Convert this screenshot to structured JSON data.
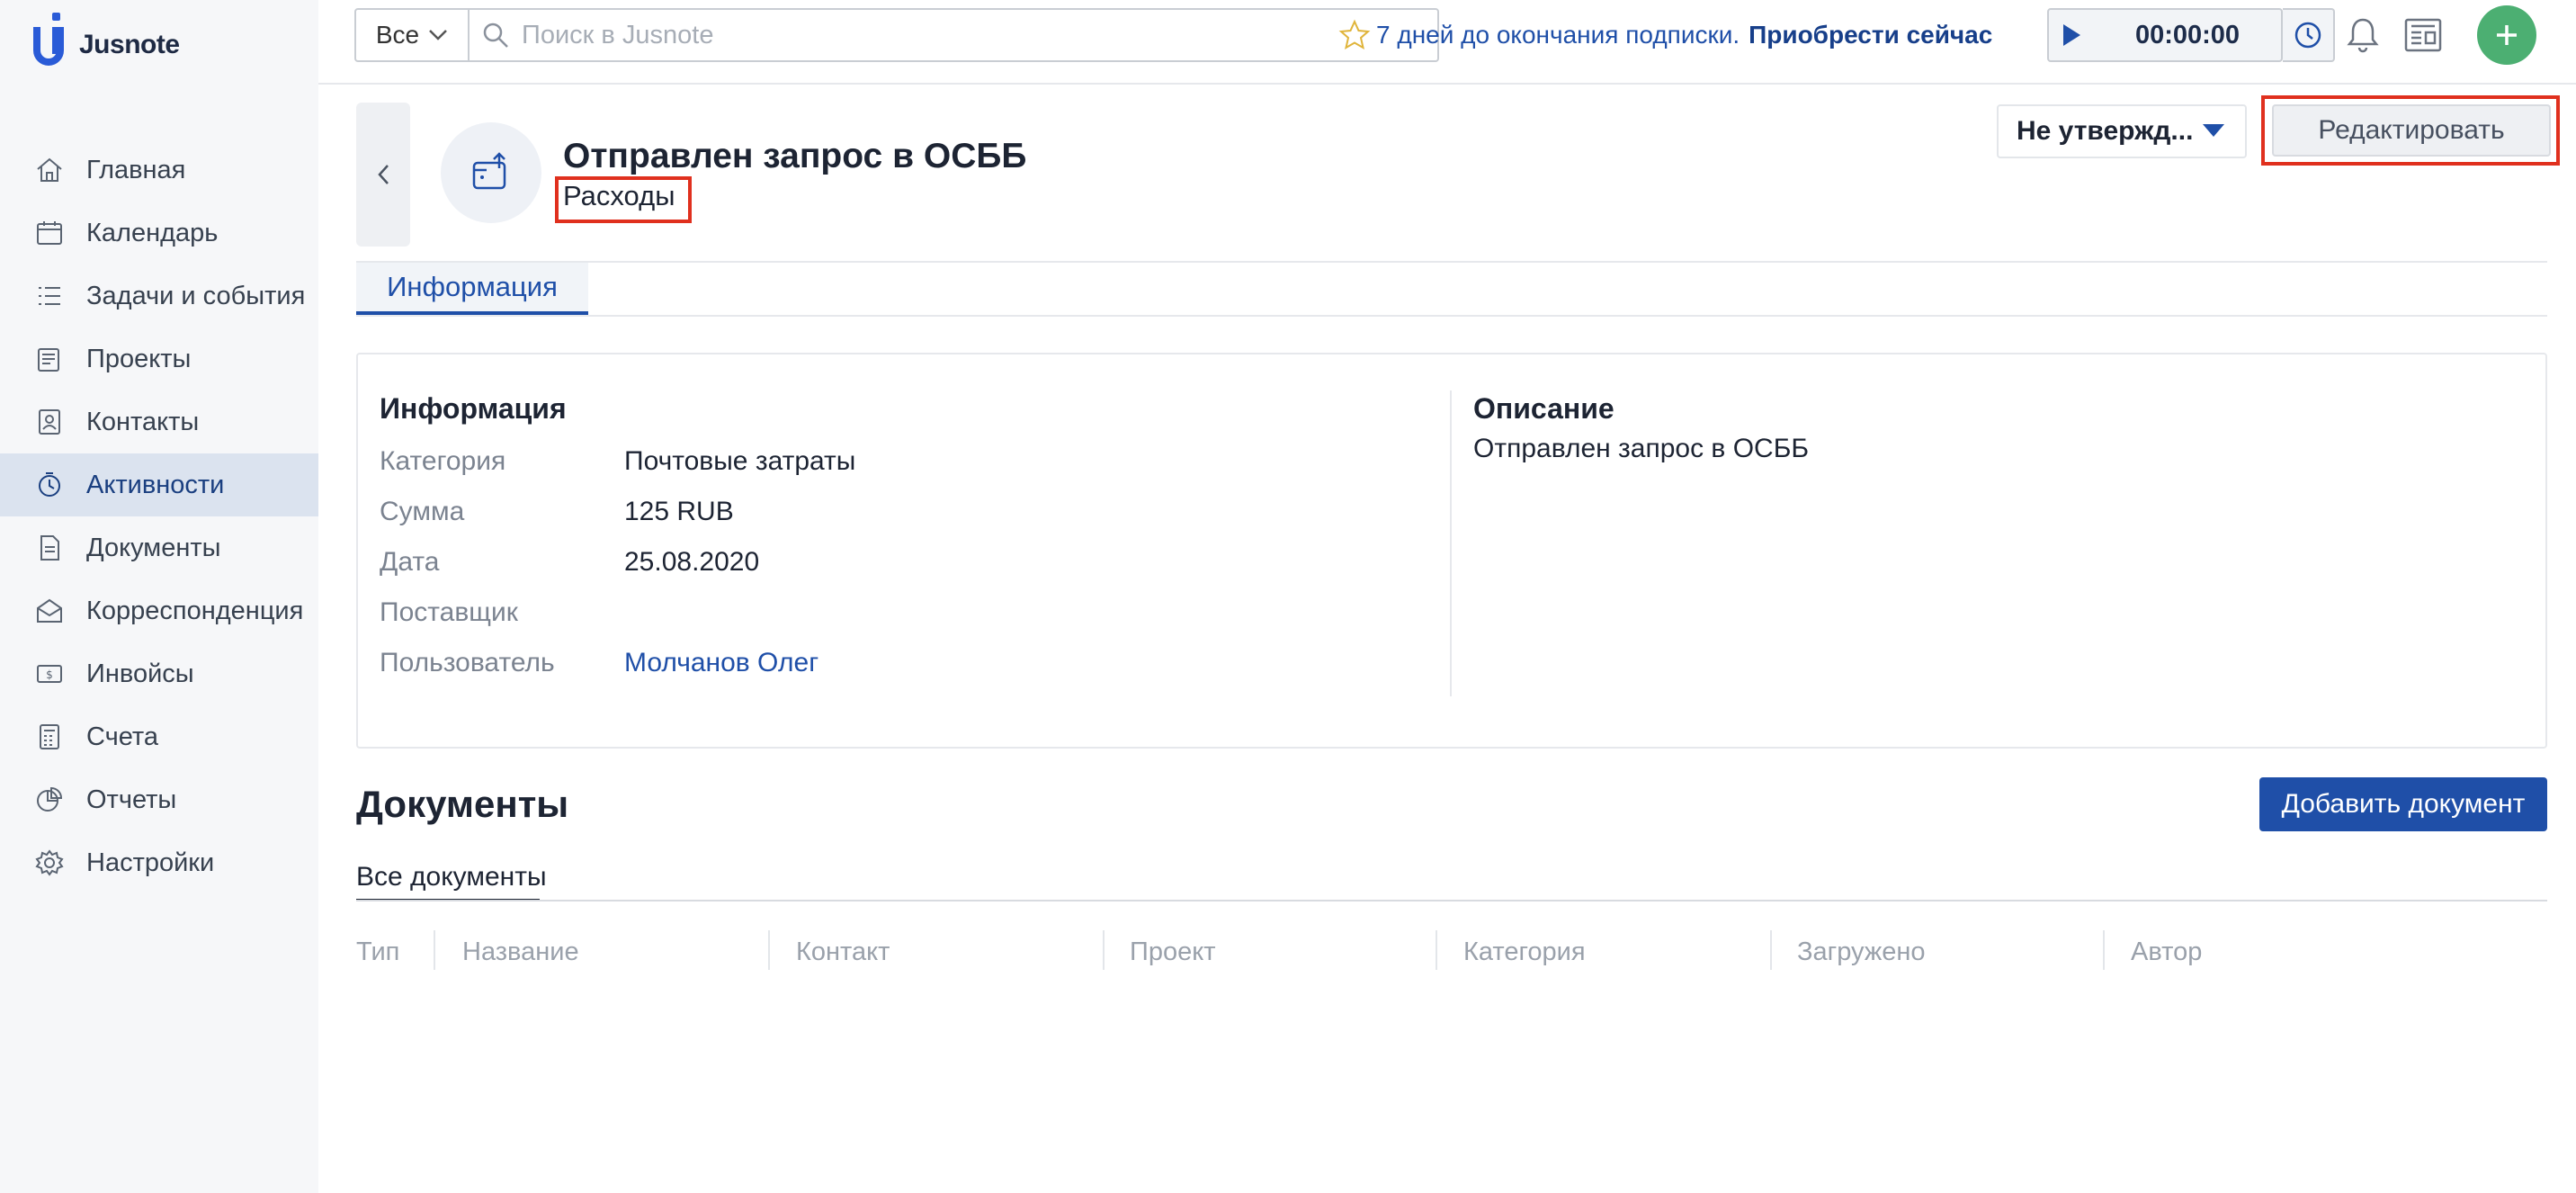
{
  "app": {
    "name": "Jusnote"
  },
  "sidebar": {
    "items": [
      {
        "label": "Главная",
        "icon": "home-icon"
      },
      {
        "label": "Календарь",
        "icon": "calendar-icon"
      },
      {
        "label": "Задачи и события",
        "icon": "tasks-icon"
      },
      {
        "label": "Проекты",
        "icon": "projects-icon"
      },
      {
        "label": "Контакты",
        "icon": "contacts-icon"
      },
      {
        "label": "Активности",
        "icon": "activities-icon",
        "active": true
      },
      {
        "label": "Документы",
        "icon": "documents-icon"
      },
      {
        "label": "Корреспонденция",
        "icon": "correspondence-icon"
      },
      {
        "label": "Инвойсы",
        "icon": "invoices-icon"
      },
      {
        "label": "Счета",
        "icon": "accounts-icon"
      },
      {
        "label": "Отчеты",
        "icon": "reports-icon"
      },
      {
        "label": "Настройки",
        "icon": "settings-icon"
      }
    ]
  },
  "topbar": {
    "search_scope": "Все",
    "search_placeholder": "Поиск в Jusnote",
    "promo_text": "7 дней до окончания подписки.",
    "promo_link": "Приобрести сейчас",
    "timer_value": "00:00:00"
  },
  "header": {
    "title": "Отправлен запрос в ОСББ",
    "subtitle": "Расходы",
    "status": "Не утвержд...",
    "edit_label": "Редактировать"
  },
  "tabs": [
    {
      "label": "Информация",
      "active": true
    }
  ],
  "info": {
    "section_title": "Информация",
    "fields": [
      {
        "label": "Категория",
        "value": "Почтовые затраты"
      },
      {
        "label": "Сумма",
        "value": "125 RUB"
      },
      {
        "label": "Дата",
        "value": "25.08.2020"
      },
      {
        "label": "Поставщик",
        "value": ""
      },
      {
        "label": "Пользователь",
        "value": "Молчанов Олег"
      }
    ],
    "description_title": "Описание",
    "description": "Отправлен запрос в ОСББ"
  },
  "documents": {
    "title": "Документы",
    "add_label": "Добавить документ",
    "tab_label": "Все документы",
    "columns": [
      "Тип",
      "Название",
      "Контакт",
      "Проект",
      "Категория",
      "Загружено",
      "Автор"
    ]
  },
  "colors": {
    "accent": "#1f4fa8",
    "add_button": "#4caf72",
    "highlight": "#e0301e",
    "sidebar_active": "#dbe3ef"
  }
}
